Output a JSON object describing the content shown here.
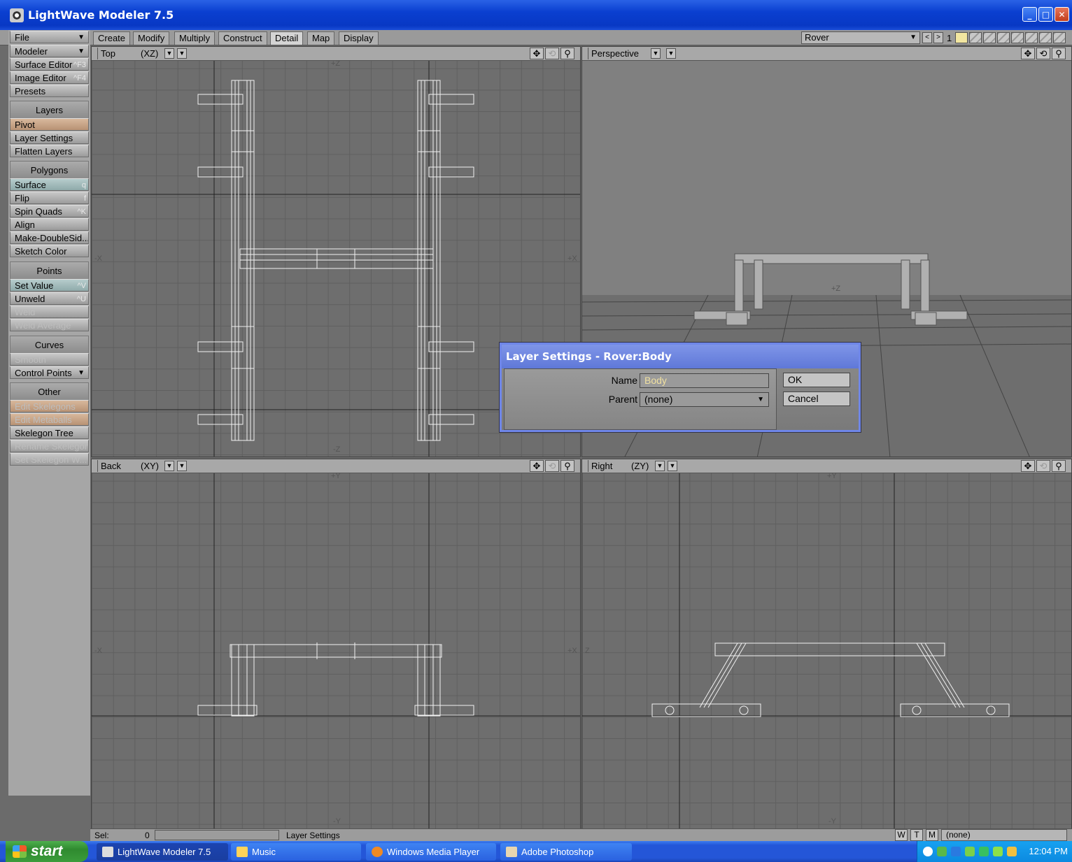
{
  "window": {
    "title": "LightWave Modeler 7.5",
    "min": "_",
    "max": "□",
    "close": "✕"
  },
  "tabs": [
    "Create",
    "Modify",
    "Multiply",
    "Construct",
    "Detail",
    "Map",
    "Display"
  ],
  "active_tab": "Detail",
  "object_selector": {
    "value": "Rover"
  },
  "layers": {
    "current_number": "1",
    "prev": "<",
    "next": ">"
  },
  "sidebar": {
    "file": "File",
    "mode": "Modeler",
    "surface_editor": {
      "label": "Surface Editor",
      "key": "^F3"
    },
    "image_editor": {
      "label": "Image Editor",
      "key": "^F4"
    },
    "presets": "Presets",
    "layers_head": "Layers",
    "pivot": "Pivot",
    "layer_settings": "Layer Settings",
    "flatten_layers": "Flatten Layers",
    "polygons_head": "Polygons",
    "surface": {
      "label": "Surface",
      "key": "q"
    },
    "flip": {
      "label": "Flip",
      "key": "f"
    },
    "spin_quads": {
      "label": "Spin Quads",
      "key": "^K"
    },
    "align": "Align",
    "make_double": "Make-DoubleSid...",
    "sketch_color": "Sketch Color",
    "points_head": "Points",
    "set_value": {
      "label": "Set Value",
      "key": "^V"
    },
    "unweld": {
      "label": "Unweld",
      "key": "^U"
    },
    "weld": "Weld",
    "weld_average": "Weld Average",
    "curves_head": "Curves",
    "smooth": "Smooth",
    "control_points": "Control Points",
    "other_head": "Other",
    "edit_skelegons": "Edit Skelegons",
    "edit_metaballs": "Edit Metaballs",
    "skelegon_tree": "Skelegon Tree",
    "rename_skelegon": "Rename Skelegon",
    "set_skelegon_w": "Set Skelegon W..."
  },
  "viewports": {
    "top": {
      "label": "Top",
      "axis": "(XZ)"
    },
    "perspective": {
      "label": "Perspective"
    },
    "back": {
      "label": "Back",
      "axis": "(XY)"
    },
    "right": {
      "label": "Right",
      "axis": "(ZY)"
    }
  },
  "axis_marks": {
    "pz": "+Z",
    "nz": "-Z",
    "nx": "-X",
    "px": "+X",
    "py": "+Y",
    "ny": "-Y",
    "z": "Z"
  },
  "dialog": {
    "title": "Layer Settings - Rover:Body",
    "name_label": "Name",
    "name_value": "Body",
    "parent_label": "Parent",
    "parent_value": "(none)",
    "ok": "OK",
    "cancel": "Cancel"
  },
  "status": {
    "sel_label": "Sel:",
    "sel_count": "0",
    "message": "Layer Settings",
    "w": "W",
    "t": "T",
    "m": "M",
    "surface": "(none)"
  },
  "taskbar": {
    "start": "start",
    "items": [
      "LightWave Modeler 7.5",
      "Music",
      "Windows Media Player",
      "Adobe Photoshop"
    ],
    "clock": "12:04 PM"
  }
}
